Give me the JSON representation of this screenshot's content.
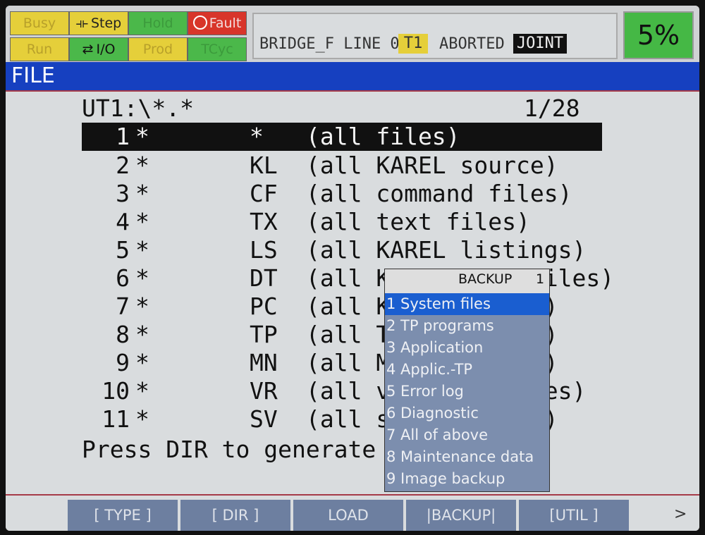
{
  "status": {
    "indicators": [
      {
        "label": "Busy",
        "glyph": "",
        "state": "off"
      },
      {
        "label": "Step",
        "glyph": "⟛",
        "state": "on"
      },
      {
        "label": "Hold",
        "glyph": "",
        "state": "off"
      },
      {
        "label": "Fault",
        "glyph": "",
        "state": "on"
      },
      {
        "label": "Run",
        "glyph": "",
        "state": "off"
      },
      {
        "label": "I/O",
        "glyph": "⇄",
        "state": "on"
      },
      {
        "label": "Prod",
        "glyph": "",
        "state": "off"
      },
      {
        "label": "TCyc",
        "glyph": "",
        "state": "off"
      }
    ],
    "program": "BRIDGE_F LINE 0",
    "tool": "T1",
    "state": "ABORTED",
    "coord": "JOINT",
    "override": "5%"
  },
  "title": "FILE",
  "file_list": {
    "path": "UT1:\\*.*",
    "page": "1/28",
    "rows": [
      {
        "num": "1",
        "star": "*",
        "ext": "*",
        "desc": "(all files)"
      },
      {
        "num": "2",
        "star": "*",
        "ext": "KL",
        "desc": "(all KAREL source)"
      },
      {
        "num": "3",
        "star": "*",
        "ext": "CF",
        "desc": "(all command files)"
      },
      {
        "num": "4",
        "star": "*",
        "ext": "TX",
        "desc": "(all text files)"
      },
      {
        "num": "5",
        "star": "*",
        "ext": "LS",
        "desc": "(all KAREL listings)"
      },
      {
        "num": "6",
        "star": "*",
        "ext": "DT",
        "desc": "(all KAREL data files)"
      },
      {
        "num": "7",
        "star": "*",
        "ext": "PC",
        "desc": "(all KAREL p-code)"
      },
      {
        "num": "8",
        "star": "*",
        "ext": "TP",
        "desc": "(all TPE programs)"
      },
      {
        "num": "9",
        "star": "*",
        "ext": "MN",
        "desc": "(all MNE programs)"
      },
      {
        "num": "10",
        "star": "*",
        "ext": "VR",
        "desc": "(all variable files)"
      },
      {
        "num": "11",
        "star": "*",
        "ext": "SV",
        "desc": "(all system files)"
      }
    ],
    "prompt": "Press DIR to generate d"
  },
  "backup_menu": {
    "title": "BACKUP",
    "page": "1",
    "items": [
      {
        "num": "1",
        "label": "System files"
      },
      {
        "num": "2",
        "label": "TP programs"
      },
      {
        "num": "3",
        "label": "Application"
      },
      {
        "num": "4",
        "label": "Applic.-TP"
      },
      {
        "num": "5",
        "label": "Error log"
      },
      {
        "num": "6",
        "label": "Diagnostic"
      },
      {
        "num": "7",
        "label": "All of above"
      },
      {
        "num": "8",
        "label": "Maintenance data"
      },
      {
        "num": "9",
        "label": "Image backup"
      }
    ]
  },
  "function_keys": {
    "f1": "[ TYPE ]",
    "f2": "[ DIR ]",
    "f3": "LOAD",
    "f4": "|BACKUP|",
    "f5": "[UTIL ]",
    "next": ">"
  }
}
